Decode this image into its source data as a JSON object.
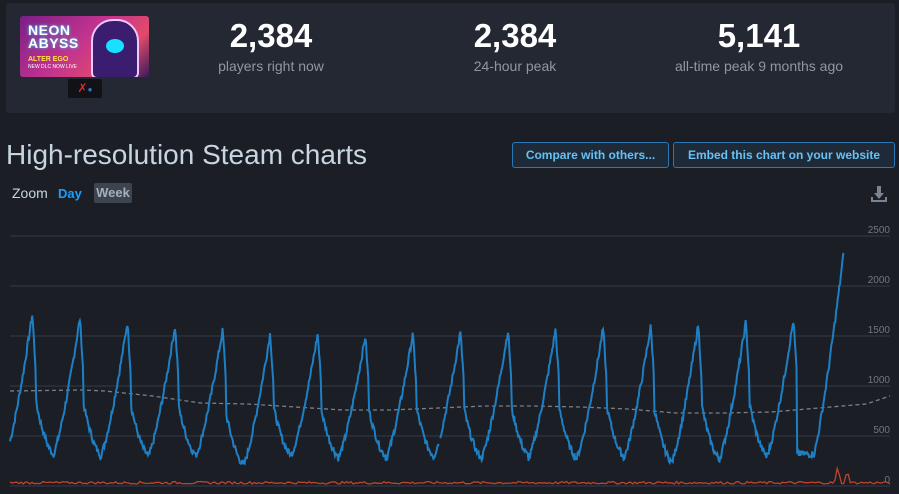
{
  "game": {
    "logo_text_line1": "NEON",
    "logo_text_line2": "ABYSS",
    "logo_subtitle": "ALTER EGO",
    "logo_subtitle2": "NEW DLC NOW LIVE"
  },
  "stats": [
    {
      "value": "2,384",
      "label": "players right now"
    },
    {
      "value": "2,384",
      "label": "24-hour peak"
    },
    {
      "value": "5,141",
      "label": "all-time peak 9 months ago"
    }
  ],
  "section_title": "High-resolution Steam charts",
  "buttons": {
    "compare": "Compare with others...",
    "embed": "Embed this chart on your website"
  },
  "zoom": {
    "label": "Zoom",
    "day": "Day",
    "week": "Week"
  },
  "colors": {
    "players_line": "#1f7fc4",
    "average_line": "#7a7f87",
    "twitch_line": "#c0442a",
    "accent": "#1a9fff"
  },
  "chart_data": {
    "type": "line",
    "ylim": [
      0,
      2700
    ],
    "y_ticks": [
      "0",
      "500",
      "1000",
      "1500",
      "2000",
      "2500"
    ],
    "grid": true,
    "x_range_days": [
      0,
      18.5
    ],
    "series": [
      {
        "role": "players",
        "daily_peaks": [
          1720,
          1680,
          1640,
          1600,
          1560,
          1530,
          1520,
          1500,
          1520,
          1540,
          1560,
          1570,
          1580,
          1600,
          1620,
          1640,
          1660,
          2420
        ],
        "daily_lows": [
          300,
          310,
          300,
          290,
          300,
          200,
          300,
          280,
          280,
          290,
          270,
          280,
          270,
          280,
          230,
          260,
          290,
          320
        ],
        "gaps_after_day": [
          9
        ],
        "end_value": 2384
      },
      {
        "role": "average",
        "points": [
          [
            0,
            950
          ],
          [
            1.5,
            960
          ],
          [
            2,
            950
          ],
          [
            3,
            900
          ],
          [
            4,
            830
          ],
          [
            5,
            820
          ],
          [
            6,
            790
          ],
          [
            7,
            760
          ],
          [
            8,
            760
          ],
          [
            9,
            780
          ],
          [
            10,
            800
          ],
          [
            11,
            800
          ],
          [
            12,
            790
          ],
          [
            13,
            770
          ],
          [
            14,
            730
          ],
          [
            15,
            730
          ],
          [
            16,
            740
          ],
          [
            17,
            780
          ],
          [
            18,
            820
          ],
          [
            18.5,
            900
          ]
        ]
      },
      {
        "role": "twitch-viewers",
        "base": 20,
        "spikes": [
          [
            17.4,
            200
          ],
          [
            17.6,
            160
          ]
        ]
      }
    ]
  }
}
